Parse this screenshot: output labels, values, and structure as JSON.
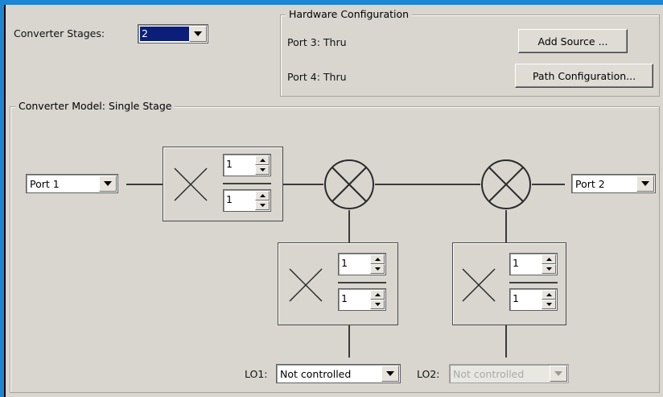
{
  "top": {
    "converter_stages_label": "Converter Stages:",
    "converter_stages_value": "2"
  },
  "hardware": {
    "legend": "Hardware Configuration",
    "port3": "Port 3: Thru",
    "port4": "Port 4: Thru",
    "add_source_label": "Add Source ...",
    "path_config_label": "Path Configuration..."
  },
  "model": {
    "legend": "Converter Model: Single Stage",
    "input_port": "Port 1",
    "output_port": "Port 2",
    "input_ratio": {
      "num": "1",
      "den": "1"
    },
    "lo1_ratio": {
      "num": "1",
      "den": "1"
    },
    "lo2_ratio": {
      "num": "1",
      "den": "1"
    },
    "lo1_label": "LO1:",
    "lo1_value": "Not controlled",
    "lo2_label": "LO2:",
    "lo2_value": "Not controlled"
  },
  "colors": {
    "title_bar": "#1a86d4",
    "panel": "#d8d6cf",
    "selection": "#0a1e7a"
  }
}
